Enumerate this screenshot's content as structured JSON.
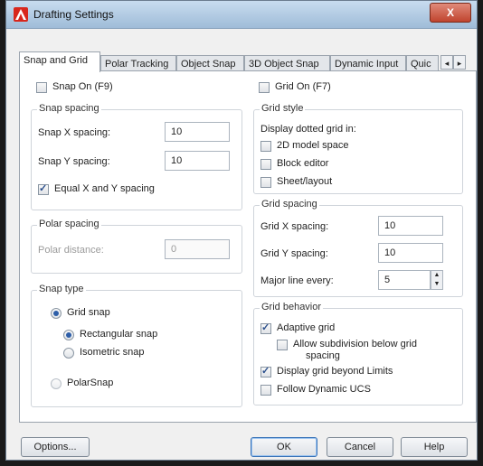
{
  "window": {
    "title": "Drafting Settings",
    "close_label": "X"
  },
  "tabs": [
    "Snap and Grid",
    "Polar Tracking",
    "Object Snap",
    "3D Object Snap",
    "Dynamic Input",
    "Quic"
  ],
  "tab_scroll": {
    "left": "◂",
    "right": "▸"
  },
  "snap_on": {
    "label": "Snap On (F9)",
    "checked": false
  },
  "grid_on": {
    "label": "Grid On (F7)",
    "checked": false
  },
  "snap_spacing": {
    "title": "Snap spacing",
    "x_label": "Snap X spacing:",
    "x_value": "10",
    "y_label": "Snap Y spacing:",
    "y_value": "10",
    "equal_label": "Equal X and Y spacing",
    "equal_checked": true
  },
  "polar_spacing": {
    "title": "Polar spacing",
    "distance_label": "Polar distance:",
    "distance_value": "0"
  },
  "snap_type": {
    "title": "Snap type",
    "grid_snap": "Grid snap",
    "rectangular": "Rectangular snap",
    "isometric": "Isometric snap",
    "polarsnap": "PolarSnap"
  },
  "grid_style": {
    "title": "Grid style",
    "subtitle": "Display dotted grid in:",
    "model_space": "2D model space",
    "block_editor": "Block editor",
    "sheet_layout": "Sheet/layout"
  },
  "grid_spacing": {
    "title": "Grid spacing",
    "x_label": "Grid X spacing:",
    "x_value": "10",
    "y_label": "Grid Y spacing:",
    "y_value": "10",
    "major_label": "Major line every:",
    "major_value": "5"
  },
  "grid_behavior": {
    "title": "Grid behavior",
    "adaptive": "Adaptive grid",
    "subdivision_line1": "Allow subdivision below grid",
    "subdivision_line2": "spacing",
    "beyond_limits": "Display grid beyond Limits",
    "follow_ucs": "Follow Dynamic UCS"
  },
  "buttons": {
    "options": "Options...",
    "ok": "OK",
    "cancel": "Cancel",
    "help": "Help"
  },
  "icons": {
    "app": "autocad-icon",
    "close": "close-icon"
  }
}
